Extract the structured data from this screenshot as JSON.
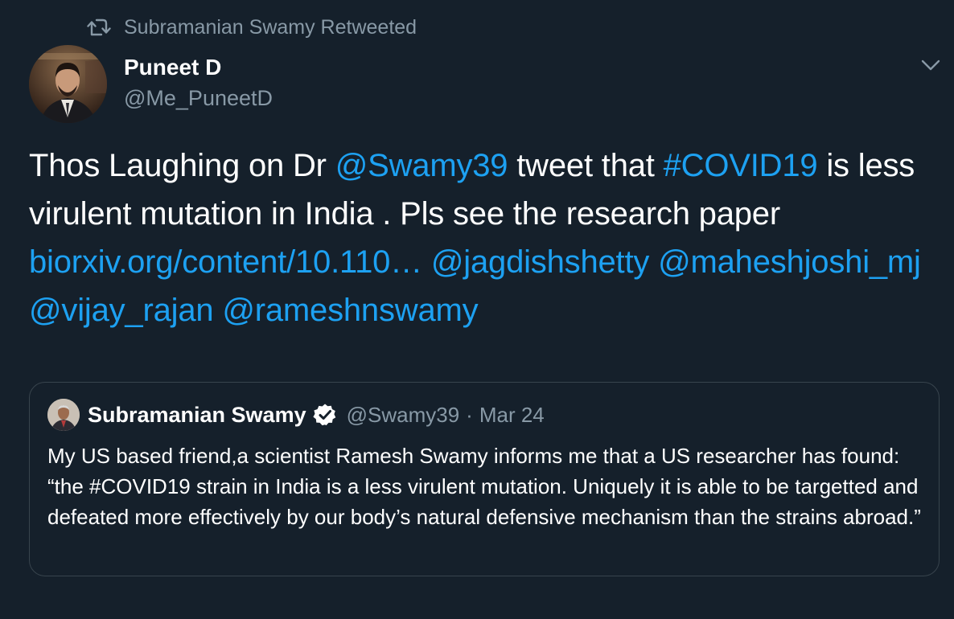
{
  "retweet_banner": {
    "label": "Subramanian Swamy Retweeted",
    "icon": "retweet-icon"
  },
  "author": {
    "name": "Puneet D",
    "handle": "@Me_PuneetD",
    "avatar_icon": "user-photo"
  },
  "menu": {
    "icon": "chevron-down-icon"
  },
  "tweet": {
    "t1": "Thos Laughing on Dr ",
    "mention_swamy": "@Swamy39",
    "t2": " tweet that ",
    "hashtag_covid": "#COVID19",
    "t3": " is less virulent mutation in India . Pls see the research paper ",
    "link": "biorxiv.org/content/10.110…",
    "t4": " ",
    "mention_jagdish": "@jagdishshetty",
    "t5": " ",
    "mention_mahesh": "@maheshjoshi_mj",
    "t6": " ",
    "mention_vijay": "@vijay_rajan",
    "t7": " ",
    "mention_ramesh": "@rameshnswamy"
  },
  "quoted_tweet": {
    "name": "Subramanian Swamy",
    "verified_icon": "verified-badge-icon",
    "handle": "@Swamy39",
    "separator": "·",
    "date": "Mar 24",
    "text": "My US based friend,a scientist Ramesh Swamy informs me that a US researcher has found: “the #COVID19 strain in India is a less virulent mutation. Uniquely it is able to be targetted and defeated more effectively by our body’s natural defensive mechanism than the strains abroad.”"
  },
  "colors": {
    "background": "#15202b",
    "link": "#1da1f2",
    "secondary_text": "#8899a6",
    "border": "#38444d"
  }
}
